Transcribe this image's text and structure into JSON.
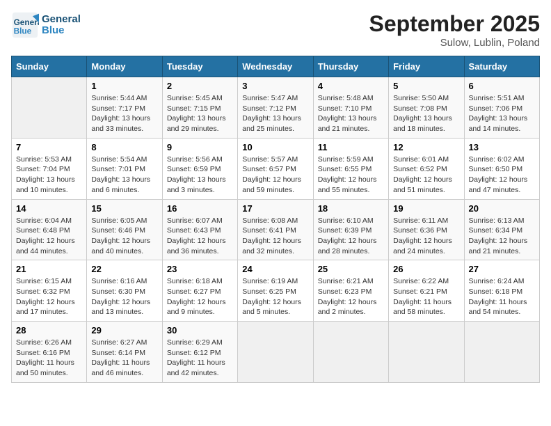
{
  "header": {
    "logo_line1": "General",
    "logo_line2": "Blue",
    "month": "September 2025",
    "location": "Sulow, Lublin, Poland"
  },
  "weekdays": [
    "Sunday",
    "Monday",
    "Tuesday",
    "Wednesday",
    "Thursday",
    "Friday",
    "Saturday"
  ],
  "weeks": [
    [
      {
        "day": "",
        "info": ""
      },
      {
        "day": "1",
        "info": "Sunrise: 5:44 AM\nSunset: 7:17 PM\nDaylight: 13 hours\nand 33 minutes."
      },
      {
        "day": "2",
        "info": "Sunrise: 5:45 AM\nSunset: 7:15 PM\nDaylight: 13 hours\nand 29 minutes."
      },
      {
        "day": "3",
        "info": "Sunrise: 5:47 AM\nSunset: 7:12 PM\nDaylight: 13 hours\nand 25 minutes."
      },
      {
        "day": "4",
        "info": "Sunrise: 5:48 AM\nSunset: 7:10 PM\nDaylight: 13 hours\nand 21 minutes."
      },
      {
        "day": "5",
        "info": "Sunrise: 5:50 AM\nSunset: 7:08 PM\nDaylight: 13 hours\nand 18 minutes."
      },
      {
        "day": "6",
        "info": "Sunrise: 5:51 AM\nSunset: 7:06 PM\nDaylight: 13 hours\nand 14 minutes."
      }
    ],
    [
      {
        "day": "7",
        "info": "Sunrise: 5:53 AM\nSunset: 7:04 PM\nDaylight: 13 hours\nand 10 minutes."
      },
      {
        "day": "8",
        "info": "Sunrise: 5:54 AM\nSunset: 7:01 PM\nDaylight: 13 hours\nand 6 minutes."
      },
      {
        "day": "9",
        "info": "Sunrise: 5:56 AM\nSunset: 6:59 PM\nDaylight: 13 hours\nand 3 minutes."
      },
      {
        "day": "10",
        "info": "Sunrise: 5:57 AM\nSunset: 6:57 PM\nDaylight: 12 hours\nand 59 minutes."
      },
      {
        "day": "11",
        "info": "Sunrise: 5:59 AM\nSunset: 6:55 PM\nDaylight: 12 hours\nand 55 minutes."
      },
      {
        "day": "12",
        "info": "Sunrise: 6:01 AM\nSunset: 6:52 PM\nDaylight: 12 hours\nand 51 minutes."
      },
      {
        "day": "13",
        "info": "Sunrise: 6:02 AM\nSunset: 6:50 PM\nDaylight: 12 hours\nand 47 minutes."
      }
    ],
    [
      {
        "day": "14",
        "info": "Sunrise: 6:04 AM\nSunset: 6:48 PM\nDaylight: 12 hours\nand 44 minutes."
      },
      {
        "day": "15",
        "info": "Sunrise: 6:05 AM\nSunset: 6:46 PM\nDaylight: 12 hours\nand 40 minutes."
      },
      {
        "day": "16",
        "info": "Sunrise: 6:07 AM\nSunset: 6:43 PM\nDaylight: 12 hours\nand 36 minutes."
      },
      {
        "day": "17",
        "info": "Sunrise: 6:08 AM\nSunset: 6:41 PM\nDaylight: 12 hours\nand 32 minutes."
      },
      {
        "day": "18",
        "info": "Sunrise: 6:10 AM\nSunset: 6:39 PM\nDaylight: 12 hours\nand 28 minutes."
      },
      {
        "day": "19",
        "info": "Sunrise: 6:11 AM\nSunset: 6:36 PM\nDaylight: 12 hours\nand 24 minutes."
      },
      {
        "day": "20",
        "info": "Sunrise: 6:13 AM\nSunset: 6:34 PM\nDaylight: 12 hours\nand 21 minutes."
      }
    ],
    [
      {
        "day": "21",
        "info": "Sunrise: 6:15 AM\nSunset: 6:32 PM\nDaylight: 12 hours\nand 17 minutes."
      },
      {
        "day": "22",
        "info": "Sunrise: 6:16 AM\nSunset: 6:30 PM\nDaylight: 12 hours\nand 13 minutes."
      },
      {
        "day": "23",
        "info": "Sunrise: 6:18 AM\nSunset: 6:27 PM\nDaylight: 12 hours\nand 9 minutes."
      },
      {
        "day": "24",
        "info": "Sunrise: 6:19 AM\nSunset: 6:25 PM\nDaylight: 12 hours\nand 5 minutes."
      },
      {
        "day": "25",
        "info": "Sunrise: 6:21 AM\nSunset: 6:23 PM\nDaylight: 12 hours\nand 2 minutes."
      },
      {
        "day": "26",
        "info": "Sunrise: 6:22 AM\nSunset: 6:21 PM\nDaylight: 11 hours\nand 58 minutes."
      },
      {
        "day": "27",
        "info": "Sunrise: 6:24 AM\nSunset: 6:18 PM\nDaylight: 11 hours\nand 54 minutes."
      }
    ],
    [
      {
        "day": "28",
        "info": "Sunrise: 6:26 AM\nSunset: 6:16 PM\nDaylight: 11 hours\nand 50 minutes."
      },
      {
        "day": "29",
        "info": "Sunrise: 6:27 AM\nSunset: 6:14 PM\nDaylight: 11 hours\nand 46 minutes."
      },
      {
        "day": "30",
        "info": "Sunrise: 6:29 AM\nSunset: 6:12 PM\nDaylight: 11 hours\nand 42 minutes."
      },
      {
        "day": "",
        "info": ""
      },
      {
        "day": "",
        "info": ""
      },
      {
        "day": "",
        "info": ""
      },
      {
        "day": "",
        "info": ""
      }
    ]
  ]
}
